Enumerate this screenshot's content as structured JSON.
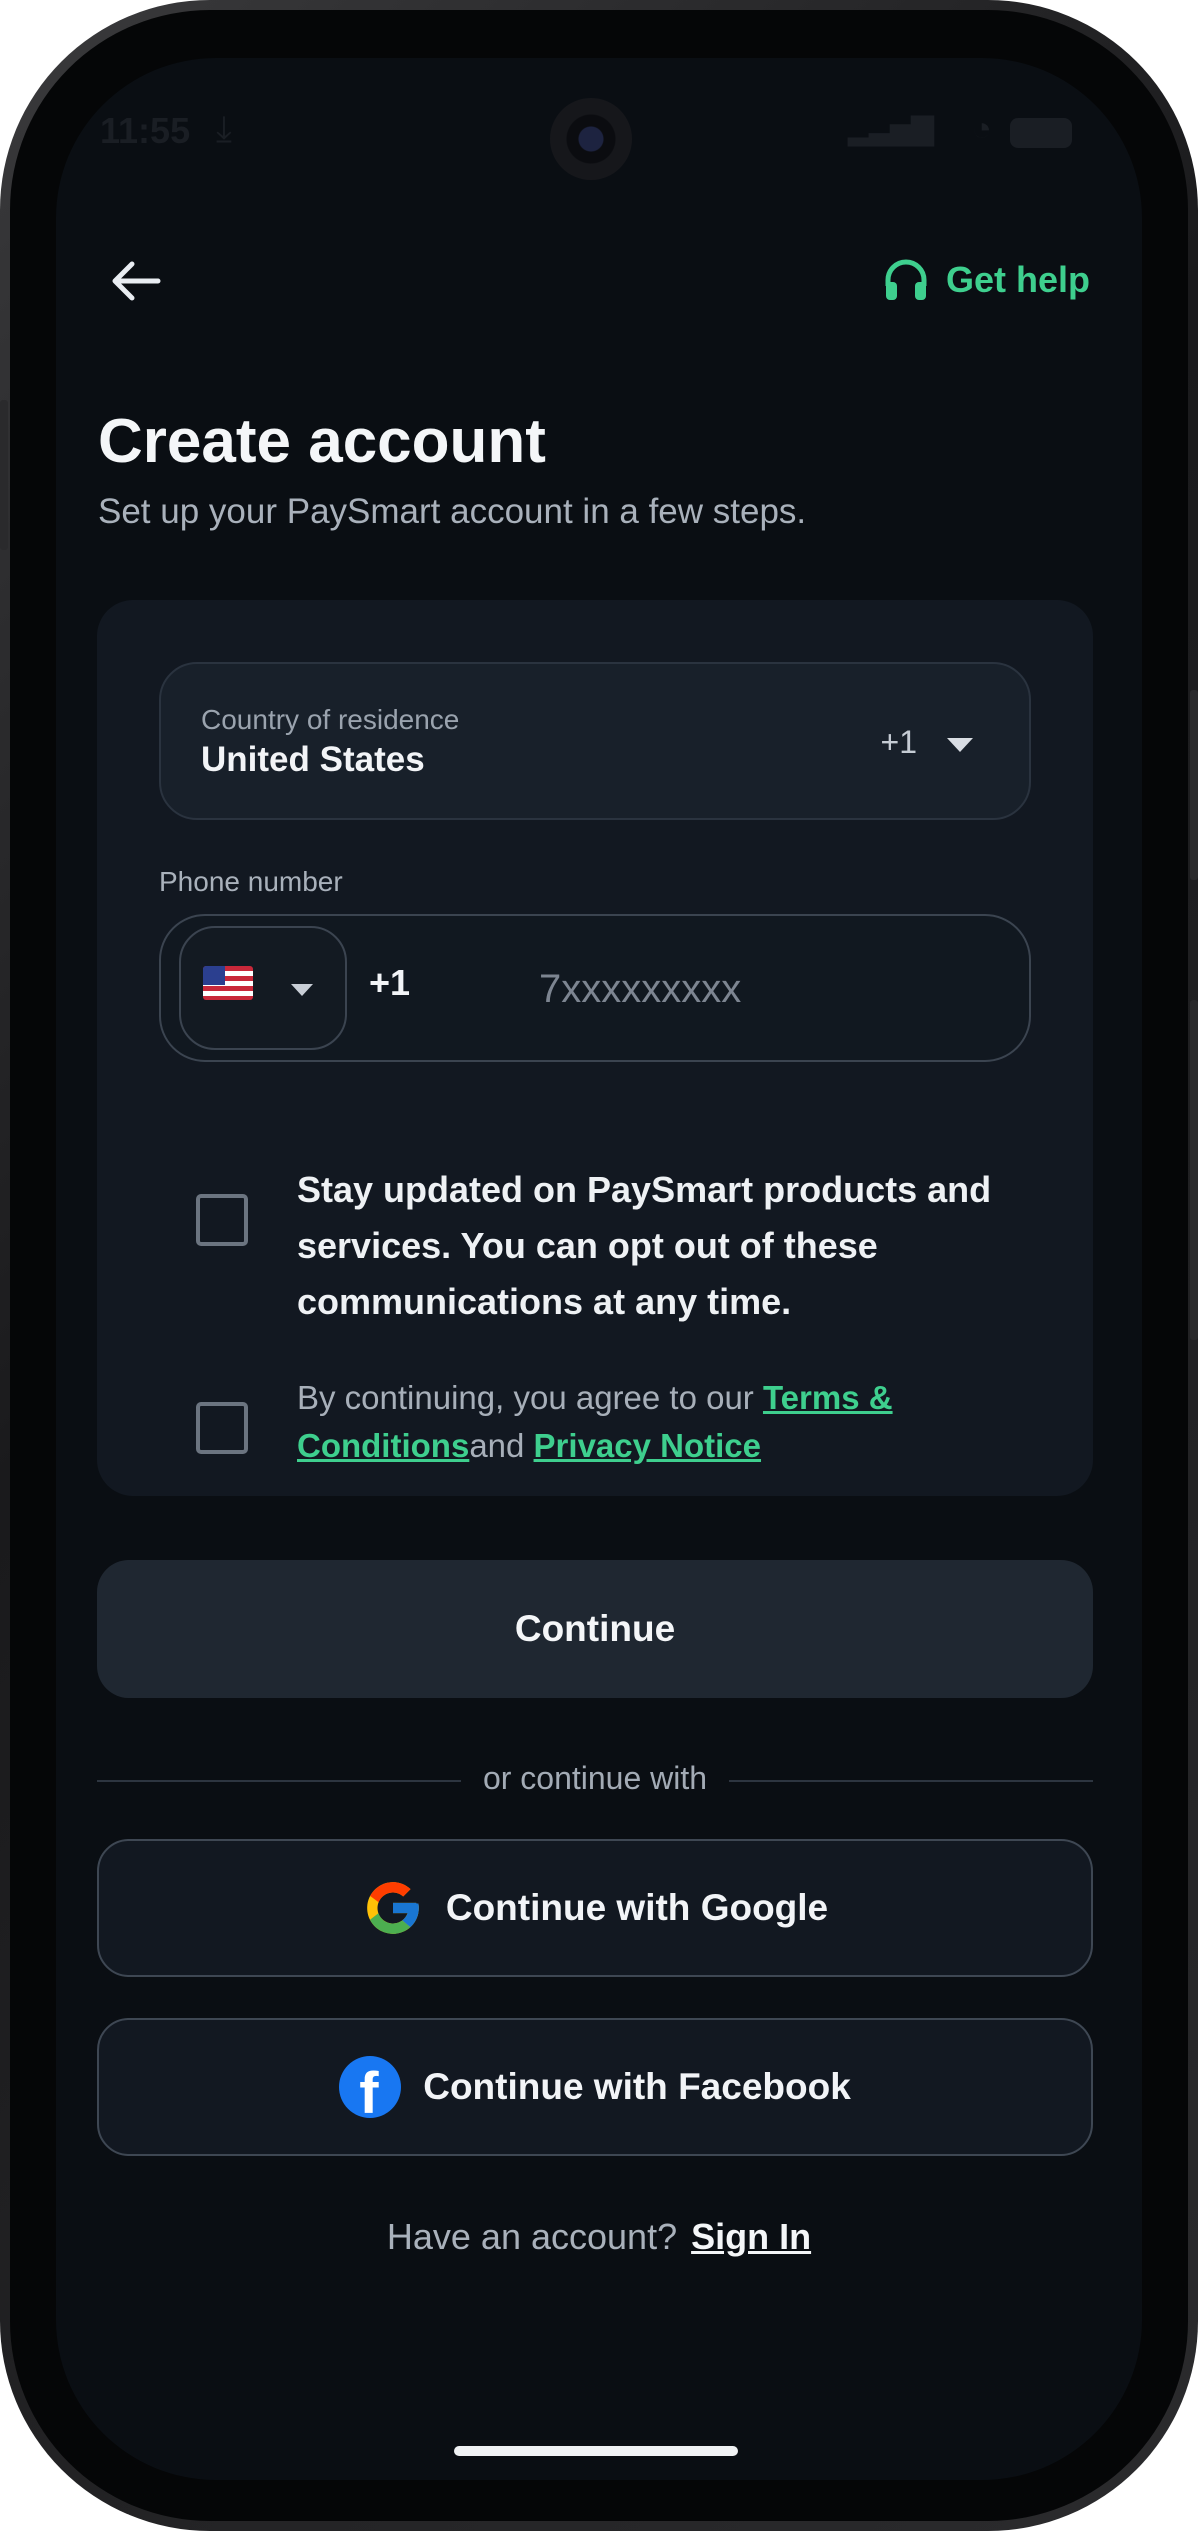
{
  "status_bar": {
    "time": "11:55"
  },
  "header": {
    "help_label": "Get help"
  },
  "page": {
    "title": "Create account",
    "subtitle": "Set up your PaySmart account in a few steps."
  },
  "country_field": {
    "label": "Country of residence",
    "value": "United States",
    "dial_code": "+1"
  },
  "phone_field": {
    "label": "Phone number",
    "flag": "🇺🇸",
    "dial_code": "+1",
    "placeholder": "7xxxxxxxxx",
    "value": ""
  },
  "consents": {
    "marketing_text": "Stay updated on PaySmart products and services. You can opt out of these communications at any time.",
    "marketing_checked": false,
    "terms_prefix": "By continuing, you agree to our ",
    "terms_link": "Terms & Conditions",
    "terms_joiner": "and ",
    "privacy_link": "Privacy Notice",
    "terms_checked": false
  },
  "actions": {
    "continue_label": "Continue",
    "divider_text": "or continue with",
    "google_label": "Continue with Google",
    "facebook_label": "Continue with Facebook"
  },
  "footer": {
    "prompt": "Have an account?",
    "signin_link": "Sign In"
  },
  "colors": {
    "accent": "#3ecf8e",
    "background": "#0a0e13",
    "card": "#121821",
    "facebook": "#1877f2"
  },
  "icons": {
    "back": "arrow-left-icon",
    "help": "headphones-icon",
    "country_dropdown": "caret-down-icon",
    "google": "google-icon",
    "facebook": "facebook-icon"
  }
}
